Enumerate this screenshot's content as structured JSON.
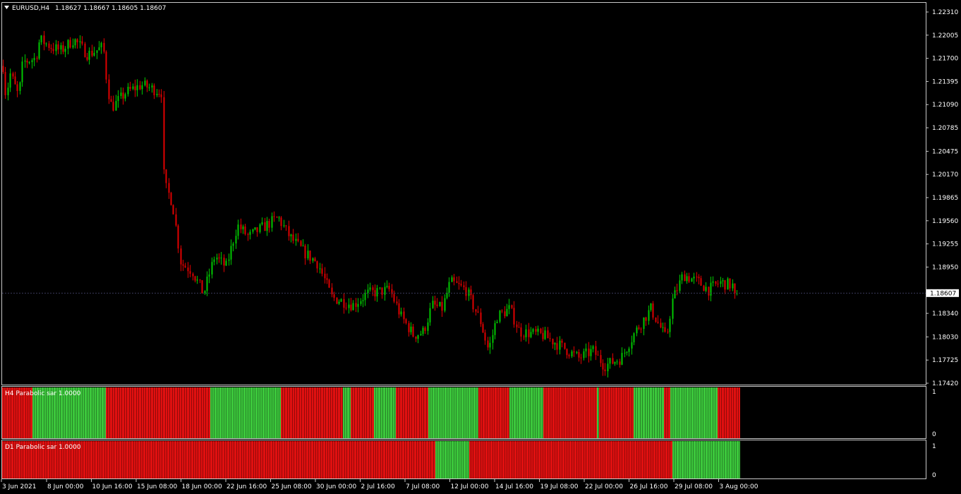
{
  "header": {
    "symbol_label": "EURUSD,H4",
    "ohlc": "1.18627 1.18667 1.18605 1.18607"
  },
  "colors": {
    "background": "#000000",
    "frame": "#c8c8c8",
    "bull": "#00c800",
    "bear": "#e00000",
    "sar_up": "#3cc83c",
    "sar_down": "#e01010",
    "text": "#ffffff"
  },
  "price_axis": {
    "ticks": [
      "1.22310",
      "1.22005",
      "1.21700",
      "1.21395",
      "1.21090",
      "1.20785",
      "1.20475",
      "1.20170",
      "1.19865",
      "1.19560",
      "1.19255",
      "1.18950",
      "1.18340",
      "1.18030",
      "1.17725",
      "1.17420"
    ],
    "current_price_label": "1.18607"
  },
  "time_axis": {
    "ticks": [
      "3 Jun 2021",
      "8 Jun 00:00",
      "10 Jun 16:00",
      "15 Jun 08:00",
      "18 Jun 00:00",
      "22 Jun 16:00",
      "25 Jun 08:00",
      "30 Jun 00:00",
      "2 Jul 16:00",
      "7 Jul 08:00",
      "12 Jul 00:00",
      "14 Jul 16:00",
      "19 Jul 08:00",
      "22 Jul 00:00",
      "26 Jul 16:00",
      "29 Jul 08:00",
      "3 Aug 00:00"
    ]
  },
  "indicators": [
    {
      "title": "H4 Parabolic sar 1.0000",
      "scale_top": "1",
      "scale_bottom": "0"
    },
    {
      "title": "D1 Parabolic sar 1.0000",
      "scale_top": "1",
      "scale_bottom": "0"
    }
  ],
  "chart_data": {
    "type": "candlestick",
    "timeframe": "H4",
    "ylim": [
      1.1742,
      1.2231
    ],
    "price_path": [
      [
        0,
        1.22
      ],
      [
        8,
        1.212
      ],
      [
        14,
        1.215
      ],
      [
        26,
        1.212
      ],
      [
        32,
        1.2165
      ],
      [
        50,
        1.217
      ],
      [
        56,
        1.2195
      ],
      [
        72,
        1.2185
      ],
      [
        86,
        1.218
      ],
      [
        104,
        1.2195
      ],
      [
        124,
        1.2175
      ],
      [
        146,
        1.2185
      ],
      [
        152,
        1.213
      ],
      [
        158,
        1.2105
      ],
      [
        178,
        1.2125
      ],
      [
        200,
        1.2135
      ],
      [
        230,
        1.2125
      ],
      [
        232,
        1.2005
      ],
      [
        244,
        1.198
      ],
      [
        256,
        1.19
      ],
      [
        272,
        1.189
      ],
      [
        288,
        1.186
      ],
      [
        304,
        1.191
      ],
      [
        320,
        1.1895
      ],
      [
        336,
        1.195
      ],
      [
        352,
        1.1935
      ],
      [
        368,
        1.1945
      ],
      [
        394,
        1.196
      ],
      [
        410,
        1.1935
      ],
      [
        430,
        1.1915
      ],
      [
        450,
        1.19
      ],
      [
        470,
        1.1855
      ],
      [
        500,
        1.1845
      ],
      [
        520,
        1.186
      ],
      [
        552,
        1.1865
      ],
      [
        568,
        1.183
      ],
      [
        586,
        1.1805
      ],
      [
        600,
        1.181
      ],
      [
        612,
        1.1845
      ],
      [
        626,
        1.184
      ],
      [
        638,
        1.1875
      ],
      [
        660,
        1.1865
      ],
      [
        680,
        1.1825
      ],
      [
        692,
        1.1785
      ],
      [
        704,
        1.183
      ],
      [
        722,
        1.184
      ],
      [
        736,
        1.181
      ],
      [
        770,
        1.1805
      ],
      [
        796,
        1.179
      ],
      [
        820,
        1.1775
      ],
      [
        840,
        1.1785
      ],
      [
        856,
        1.1765
      ],
      [
        880,
        1.1775
      ],
      [
        900,
        1.181
      ],
      [
        922,
        1.184
      ],
      [
        944,
        1.18
      ],
      [
        952,
        1.185
      ],
      [
        968,
        1.1885
      ],
      [
        990,
        1.1875
      ],
      [
        1004,
        1.1865
      ],
      [
        1020,
        1.1875
      ],
      [
        1040,
        1.187
      ],
      [
        1045,
        1.18607
      ]
    ],
    "current_price": 1.18607,
    "h4_sar_segments": [
      {
        "from": 3,
        "to": 46,
        "state": "down"
      },
      {
        "from": 46,
        "to": 150,
        "state": "up"
      },
      {
        "from": 150,
        "to": 298,
        "state": "down"
      },
      {
        "from": 298,
        "to": 398,
        "state": "up"
      },
      {
        "from": 398,
        "to": 486,
        "state": "down"
      },
      {
        "from": 486,
        "to": 497,
        "state": "up"
      },
      {
        "from": 497,
        "to": 530,
        "state": "down"
      },
      {
        "from": 530,
        "to": 561,
        "state": "up"
      },
      {
        "from": 561,
        "to": 607,
        "state": "down"
      },
      {
        "from": 607,
        "to": 678,
        "state": "up"
      },
      {
        "from": 678,
        "to": 722,
        "state": "down"
      },
      {
        "from": 722,
        "to": 770,
        "state": "up"
      },
      {
        "from": 770,
        "to": 846,
        "state": "down"
      },
      {
        "from": 846,
        "to": 849,
        "state": "up"
      },
      {
        "from": 849,
        "to": 898,
        "state": "down"
      },
      {
        "from": 898,
        "to": 941,
        "state": "up"
      },
      {
        "from": 941,
        "to": 950,
        "state": "down"
      },
      {
        "from": 950,
        "to": 1017,
        "state": "up"
      },
      {
        "from": 1017,
        "to": 1049,
        "state": "down"
      }
    ],
    "d1_sar_segments": [
      {
        "from": 3,
        "to": 617,
        "state": "down"
      },
      {
        "from": 617,
        "to": 665,
        "state": "up"
      },
      {
        "from": 665,
        "to": 953,
        "state": "down"
      },
      {
        "from": 953,
        "to": 1049,
        "state": "up"
      }
    ]
  }
}
